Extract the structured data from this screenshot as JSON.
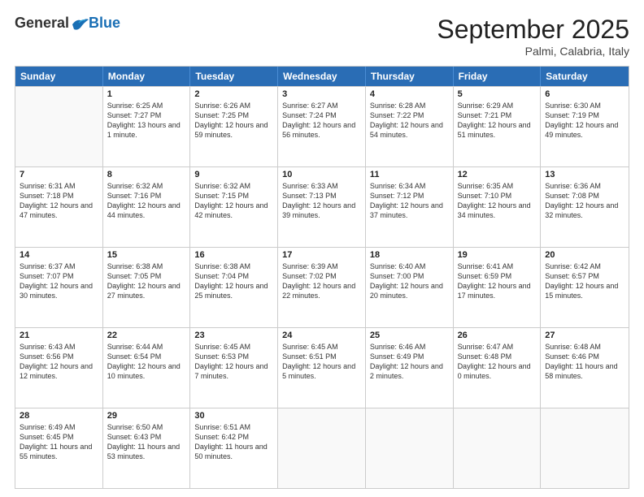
{
  "logo": {
    "general": "General",
    "blue": "Blue"
  },
  "title": "September 2025",
  "subtitle": "Palmi, Calabria, Italy",
  "header_days": [
    "Sunday",
    "Monday",
    "Tuesday",
    "Wednesday",
    "Thursday",
    "Friday",
    "Saturday"
  ],
  "weeks": [
    [
      {
        "day": "",
        "sunrise": "",
        "sunset": "",
        "daylight": ""
      },
      {
        "day": "1",
        "sunrise": "Sunrise: 6:25 AM",
        "sunset": "Sunset: 7:27 PM",
        "daylight": "Daylight: 13 hours and 1 minute."
      },
      {
        "day": "2",
        "sunrise": "Sunrise: 6:26 AM",
        "sunset": "Sunset: 7:25 PM",
        "daylight": "Daylight: 12 hours and 59 minutes."
      },
      {
        "day": "3",
        "sunrise": "Sunrise: 6:27 AM",
        "sunset": "Sunset: 7:24 PM",
        "daylight": "Daylight: 12 hours and 56 minutes."
      },
      {
        "day": "4",
        "sunrise": "Sunrise: 6:28 AM",
        "sunset": "Sunset: 7:22 PM",
        "daylight": "Daylight: 12 hours and 54 minutes."
      },
      {
        "day": "5",
        "sunrise": "Sunrise: 6:29 AM",
        "sunset": "Sunset: 7:21 PM",
        "daylight": "Daylight: 12 hours and 51 minutes."
      },
      {
        "day": "6",
        "sunrise": "Sunrise: 6:30 AM",
        "sunset": "Sunset: 7:19 PM",
        "daylight": "Daylight: 12 hours and 49 minutes."
      }
    ],
    [
      {
        "day": "7",
        "sunrise": "Sunrise: 6:31 AM",
        "sunset": "Sunset: 7:18 PM",
        "daylight": "Daylight: 12 hours and 47 minutes."
      },
      {
        "day": "8",
        "sunrise": "Sunrise: 6:32 AM",
        "sunset": "Sunset: 7:16 PM",
        "daylight": "Daylight: 12 hours and 44 minutes."
      },
      {
        "day": "9",
        "sunrise": "Sunrise: 6:32 AM",
        "sunset": "Sunset: 7:15 PM",
        "daylight": "Daylight: 12 hours and 42 minutes."
      },
      {
        "day": "10",
        "sunrise": "Sunrise: 6:33 AM",
        "sunset": "Sunset: 7:13 PM",
        "daylight": "Daylight: 12 hours and 39 minutes."
      },
      {
        "day": "11",
        "sunrise": "Sunrise: 6:34 AM",
        "sunset": "Sunset: 7:12 PM",
        "daylight": "Daylight: 12 hours and 37 minutes."
      },
      {
        "day": "12",
        "sunrise": "Sunrise: 6:35 AM",
        "sunset": "Sunset: 7:10 PM",
        "daylight": "Daylight: 12 hours and 34 minutes."
      },
      {
        "day": "13",
        "sunrise": "Sunrise: 6:36 AM",
        "sunset": "Sunset: 7:08 PM",
        "daylight": "Daylight: 12 hours and 32 minutes."
      }
    ],
    [
      {
        "day": "14",
        "sunrise": "Sunrise: 6:37 AM",
        "sunset": "Sunset: 7:07 PM",
        "daylight": "Daylight: 12 hours and 30 minutes."
      },
      {
        "day": "15",
        "sunrise": "Sunrise: 6:38 AM",
        "sunset": "Sunset: 7:05 PM",
        "daylight": "Daylight: 12 hours and 27 minutes."
      },
      {
        "day": "16",
        "sunrise": "Sunrise: 6:38 AM",
        "sunset": "Sunset: 7:04 PM",
        "daylight": "Daylight: 12 hours and 25 minutes."
      },
      {
        "day": "17",
        "sunrise": "Sunrise: 6:39 AM",
        "sunset": "Sunset: 7:02 PM",
        "daylight": "Daylight: 12 hours and 22 minutes."
      },
      {
        "day": "18",
        "sunrise": "Sunrise: 6:40 AM",
        "sunset": "Sunset: 7:00 PM",
        "daylight": "Daylight: 12 hours and 20 minutes."
      },
      {
        "day": "19",
        "sunrise": "Sunrise: 6:41 AM",
        "sunset": "Sunset: 6:59 PM",
        "daylight": "Daylight: 12 hours and 17 minutes."
      },
      {
        "day": "20",
        "sunrise": "Sunrise: 6:42 AM",
        "sunset": "Sunset: 6:57 PM",
        "daylight": "Daylight: 12 hours and 15 minutes."
      }
    ],
    [
      {
        "day": "21",
        "sunrise": "Sunrise: 6:43 AM",
        "sunset": "Sunset: 6:56 PM",
        "daylight": "Daylight: 12 hours and 12 minutes."
      },
      {
        "day": "22",
        "sunrise": "Sunrise: 6:44 AM",
        "sunset": "Sunset: 6:54 PM",
        "daylight": "Daylight: 12 hours and 10 minutes."
      },
      {
        "day": "23",
        "sunrise": "Sunrise: 6:45 AM",
        "sunset": "Sunset: 6:53 PM",
        "daylight": "Daylight: 12 hours and 7 minutes."
      },
      {
        "day": "24",
        "sunrise": "Sunrise: 6:45 AM",
        "sunset": "Sunset: 6:51 PM",
        "daylight": "Daylight: 12 hours and 5 minutes."
      },
      {
        "day": "25",
        "sunrise": "Sunrise: 6:46 AM",
        "sunset": "Sunset: 6:49 PM",
        "daylight": "Daylight: 12 hours and 2 minutes."
      },
      {
        "day": "26",
        "sunrise": "Sunrise: 6:47 AM",
        "sunset": "Sunset: 6:48 PM",
        "daylight": "Daylight: 12 hours and 0 minutes."
      },
      {
        "day": "27",
        "sunrise": "Sunrise: 6:48 AM",
        "sunset": "Sunset: 6:46 PM",
        "daylight": "Daylight: 11 hours and 58 minutes."
      }
    ],
    [
      {
        "day": "28",
        "sunrise": "Sunrise: 6:49 AM",
        "sunset": "Sunset: 6:45 PM",
        "daylight": "Daylight: 11 hours and 55 minutes."
      },
      {
        "day": "29",
        "sunrise": "Sunrise: 6:50 AM",
        "sunset": "Sunset: 6:43 PM",
        "daylight": "Daylight: 11 hours and 53 minutes."
      },
      {
        "day": "30",
        "sunrise": "Sunrise: 6:51 AM",
        "sunset": "Sunset: 6:42 PM",
        "daylight": "Daylight: 11 hours and 50 minutes."
      },
      {
        "day": "",
        "sunrise": "",
        "sunset": "",
        "daylight": ""
      },
      {
        "day": "",
        "sunrise": "",
        "sunset": "",
        "daylight": ""
      },
      {
        "day": "",
        "sunrise": "",
        "sunset": "",
        "daylight": ""
      },
      {
        "day": "",
        "sunrise": "",
        "sunset": "",
        "daylight": ""
      }
    ]
  ]
}
